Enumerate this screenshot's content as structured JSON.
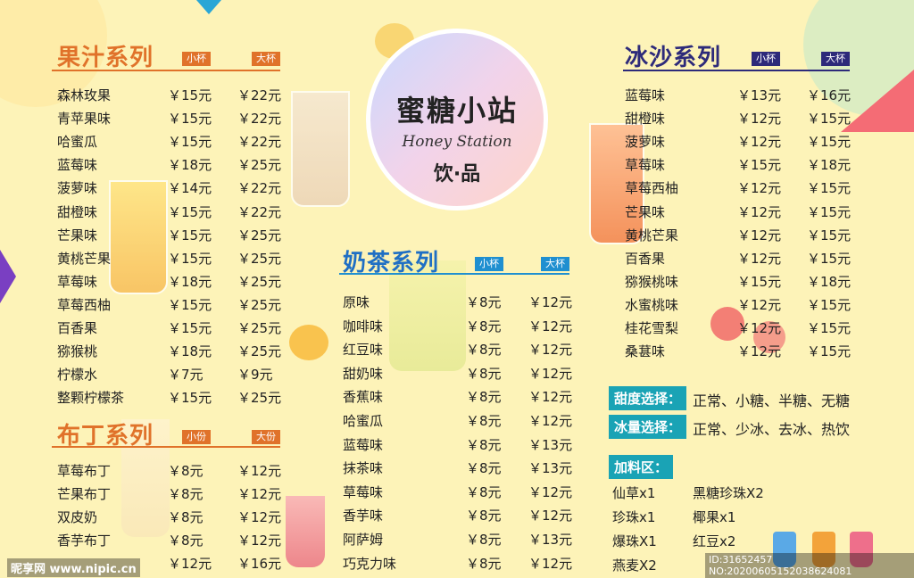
{
  "brand": {
    "name_cn": "蜜糖小站",
    "name_en": "Honey Station",
    "subtitle": "饮·品"
  },
  "juice": {
    "title": "果汁系列",
    "size_small": "小杯",
    "size_large": "大杯",
    "items": [
      {
        "name": "森林玫果",
        "small": "￥15元",
        "large": "￥22元"
      },
      {
        "name": "青苹果味",
        "small": "￥15元",
        "large": "￥22元"
      },
      {
        "name": "哈蜜瓜",
        "small": "￥15元",
        "large": "￥22元"
      },
      {
        "name": "蓝莓味",
        "small": "￥18元",
        "large": "￥25元"
      },
      {
        "name": "菠萝味",
        "small": "￥14元",
        "large": "￥22元"
      },
      {
        "name": "甜橙味",
        "small": "￥15元",
        "large": "￥22元"
      },
      {
        "name": "芒果味",
        "small": "￥15元",
        "large": "￥25元"
      },
      {
        "name": "黄桃芒果",
        "small": "￥15元",
        "large": "￥25元"
      },
      {
        "name": "草莓味",
        "small": "￥18元",
        "large": "￥25元"
      },
      {
        "name": "草莓西柚",
        "small": "￥15元",
        "large": "￥25元"
      },
      {
        "name": "百香果",
        "small": "￥15元",
        "large": "￥25元"
      },
      {
        "name": "猕猴桃",
        "small": "￥18元",
        "large": "￥25元"
      },
      {
        "name": "柠檬水",
        "small": "￥7元",
        "large": "￥9元"
      },
      {
        "name": "整颗柠檬茶",
        "small": "￥15元",
        "large": "￥25元"
      }
    ]
  },
  "pudding": {
    "title": "布丁系列",
    "size_small": "小份",
    "size_large": "大份",
    "items": [
      {
        "name": "草莓布丁",
        "small": "￥8元",
        "large": "￥12元"
      },
      {
        "name": "芒果布丁",
        "small": "￥8元",
        "large": "￥12元"
      },
      {
        "name": "双皮奶",
        "small": "￥8元",
        "large": "￥12元"
      },
      {
        "name": "香芋布丁",
        "small": "￥8元",
        "large": "￥12元"
      },
      {
        "name": "",
        "small": "￥12元",
        "large": "￥16元"
      }
    ]
  },
  "milktea": {
    "title": "奶茶系列",
    "size_small": "小杯",
    "size_large": "大杯",
    "items": [
      {
        "name": "原味",
        "small": "￥8元",
        "large": "￥12元"
      },
      {
        "name": "咖啡味",
        "small": "￥8元",
        "large": "￥12元"
      },
      {
        "name": "红豆味",
        "small": "￥8元",
        "large": "￥12元"
      },
      {
        "name": "甜奶味",
        "small": "￥8元",
        "large": "￥12元"
      },
      {
        "name": "香蕉味",
        "small": "￥8元",
        "large": "￥12元"
      },
      {
        "name": "哈蜜瓜",
        "small": "￥8元",
        "large": "￥12元"
      },
      {
        "name": "蓝莓味",
        "small": "￥8元",
        "large": "￥13元"
      },
      {
        "name": "抹茶味",
        "small": "￥8元",
        "large": "￥13元"
      },
      {
        "name": "草莓味",
        "small": "￥8元",
        "large": "￥12元"
      },
      {
        "name": "香芋味",
        "small": "￥8元",
        "large": "￥12元"
      },
      {
        "name": "阿萨姆",
        "small": "￥8元",
        "large": "￥13元"
      },
      {
        "name": "巧克力味",
        "small": "￥8元",
        "large": "￥12元"
      }
    ]
  },
  "smoothie": {
    "title": "冰沙系列",
    "size_small": "小杯",
    "size_large": "大杯",
    "items": [
      {
        "name": "蓝莓味",
        "small": "￥13元",
        "large": "￥16元"
      },
      {
        "name": "甜橙味",
        "small": "￥12元",
        "large": "￥15元"
      },
      {
        "name": "菠萝味",
        "small": "￥12元",
        "large": "￥15元"
      },
      {
        "name": "草莓味",
        "small": "￥15元",
        "large": "￥18元"
      },
      {
        "name": "草莓西柚",
        "small": "￥12元",
        "large": "￥15元"
      },
      {
        "name": "芒果味",
        "small": "￥12元",
        "large": "￥15元"
      },
      {
        "name": "黄桃芒果",
        "small": "￥12元",
        "large": "￥15元"
      },
      {
        "name": "百香果",
        "small": "￥12元",
        "large": "￥15元"
      },
      {
        "name": "猕猴桃味",
        "small": "￥15元",
        "large": "￥18元"
      },
      {
        "name": "水蜜桃味",
        "small": "￥12元",
        "large": "￥15元"
      },
      {
        "name": "桂花雪梨",
        "small": "￥12元",
        "large": "￥15元"
      },
      {
        "name": "桑葚味",
        "small": "￥12元",
        "large": "￥15元"
      }
    ]
  },
  "options": {
    "sweet_label": "甜度选择：",
    "sweet_text": "正常、小糖、半糖、无糖",
    "ice_label": "冰量选择：",
    "ice_text": "正常、少冰、去冰、热饮",
    "toppings_label": "加料区：",
    "toppings": [
      "仙草x1",
      "黑糖珍珠X2",
      "珍珠x1",
      "椰果x1",
      "爆珠X1",
      "红豆x2",
      "燕麦X2"
    ]
  },
  "watermark": {
    "site": "昵享网 www.nipic.cn",
    "id": "ID:31652457 NO:20200605152038624081"
  },
  "colors": {
    "juice": "#e0722a",
    "pudding": "#e0722a",
    "milktea": "#1f6fc4",
    "smoothie": "#2d2a7a",
    "bg": "#fdf3b8"
  }
}
